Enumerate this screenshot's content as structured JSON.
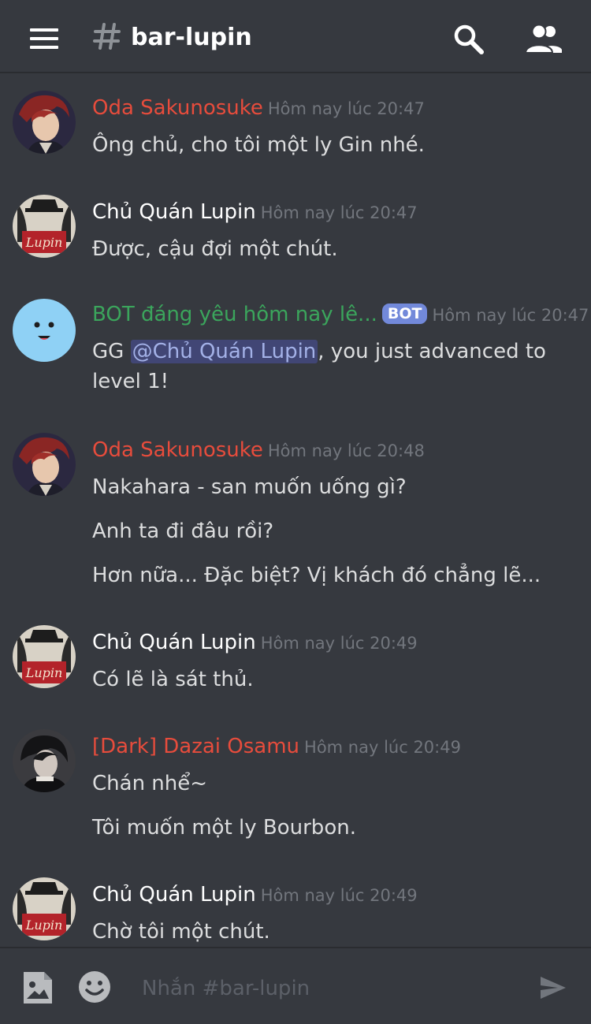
{
  "header": {
    "channel_name": "bar-lupin"
  },
  "messages": [
    {
      "author": "Oda Sakunosuke",
      "author_color": "#e74c3c",
      "timestamp": "Hôm nay lúc 20:47",
      "lines": [
        "Ông chủ, cho tôi một ly Gin nhé."
      ]
    },
    {
      "author": "Chủ Quán Lupin",
      "author_color": "#ffffff",
      "timestamp": "Hôm nay lúc 20:47",
      "lines": [
        "Được, cậu đợi một chút."
      ]
    },
    {
      "author": "BOT đáng yêu hôm nay lê...",
      "author_color": "#3ba55c",
      "badge": "BOT",
      "timestamp": "Hôm nay lúc 20:47",
      "line1_prefix": "GG ",
      "mention": "@Chủ Quán Lupin",
      "line1_suffix": ", you just advanced to",
      "line2": "level 1!"
    },
    {
      "author": "Oda Sakunosuke",
      "author_color": "#e74c3c",
      "timestamp": "Hôm nay lúc 20:48",
      "lines": [
        "Nakahara - san muốn uống gì?",
        "Anh ta đi đâu rồi?",
        "Hơn nữa... Đặc biệt? Vị khách đó chẳng lẽ..."
      ]
    },
    {
      "author": "Chủ Quán Lupin",
      "author_color": "#ffffff",
      "timestamp": "Hôm nay lúc 20:49",
      "lines": [
        "Có lẽ là sát thủ."
      ]
    },
    {
      "author": "[Dark] Dazai Osamu",
      "author_color": "#e74c3c",
      "timestamp": "Hôm nay lúc 20:49",
      "lines": [
        "Chán nhể~",
        "Tôi muốn một ly Bourbon."
      ]
    },
    {
      "author": "Chủ Quán Lupin",
      "author_color": "#ffffff",
      "timestamp": "Hôm nay lúc 20:49",
      "lines": [
        "Chờ tôi một chút."
      ]
    }
  ],
  "avatars": {
    "lupin_sign_text": "Lupin"
  },
  "composer": {
    "placeholder": "Nhắn #bar-lupin"
  },
  "colors": {
    "background": "#36393f",
    "timestamp": "#72767d",
    "bot_badge": "#7289da",
    "mention_bg": "#414675",
    "mention_text": "#a3b1e7"
  },
  "icons": [
    "menu-icon",
    "hash-icon",
    "search-icon",
    "members-icon",
    "image-icon",
    "emoji-icon",
    "send-icon"
  ]
}
